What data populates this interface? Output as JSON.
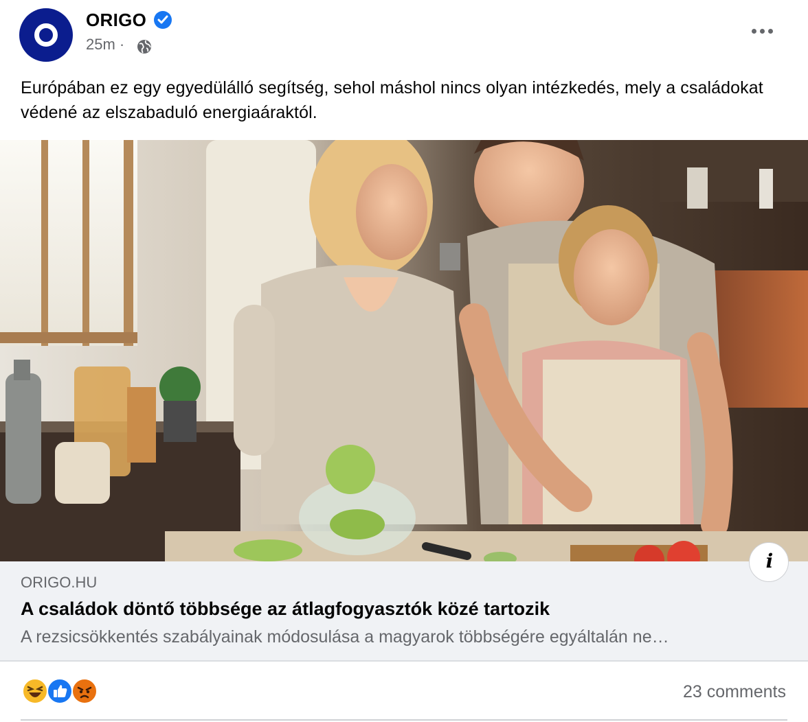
{
  "post": {
    "page_name": "ORIGO",
    "time": "25m",
    "time_separator": "·",
    "text": "Európában ez egy egyedülálló segítség, sehol máshol nincs olyan intézkedés, mely a családokat védené az elszabaduló energiaáraktól."
  },
  "link": {
    "domain": "ORIGO.HU",
    "title": "A családok döntő többsége az átlagfogyasztók közé tartozik",
    "description": "A rezsicsökkentés szabályainak módosulása a magyarok többségére egyáltalán ne…",
    "info_icon_label": "i"
  },
  "footer": {
    "comments": "23 comments",
    "reactions": [
      "haha",
      "like",
      "angry"
    ]
  },
  "icons": {
    "avatar": "origo-logo",
    "verified": "verified-badge-icon",
    "audience": "globe-icon",
    "menu": "more-options-icon",
    "info": "info-icon"
  },
  "colors": {
    "brand": "#0b1d8e",
    "verified": "#1877f2",
    "link_box_bg": "#f0f2f5",
    "muted_text": "#65676b"
  }
}
